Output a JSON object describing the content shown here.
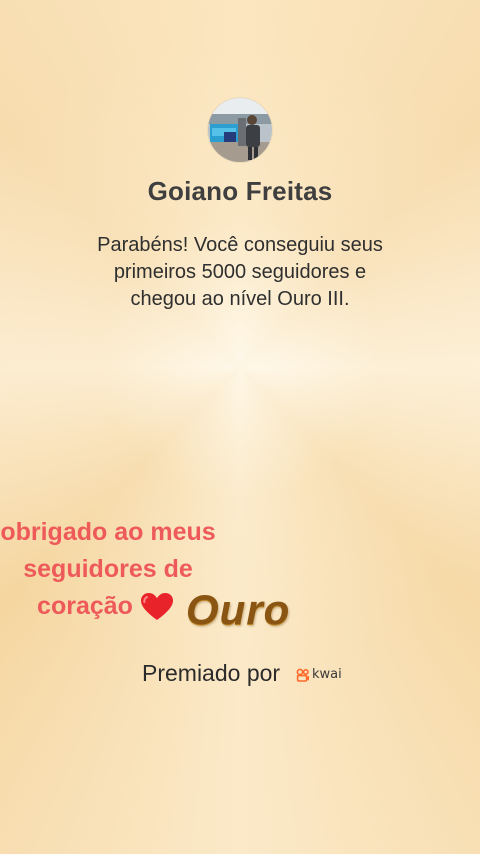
{
  "profile": {
    "name": "Goiano Freitas",
    "avatar_icon": "profile-photo"
  },
  "message": {
    "line1": "Parabéns! Você conseguiu seus",
    "line2": "primeiros 5000 seguidores e",
    "line3": "chegou ao nível Ouro III."
  },
  "overlay": {
    "line1": "obrigado ao meus",
    "line2": "seguidores de",
    "line3": "coração",
    "heart_icon": "red-heart-icon",
    "color": "#ee5a5a"
  },
  "badge": {
    "label": "Ouro",
    "color": "#8a5512"
  },
  "footer": {
    "prefix": "Premiado por",
    "brand": "kwai",
    "brand_color": "#ff6a2a"
  }
}
